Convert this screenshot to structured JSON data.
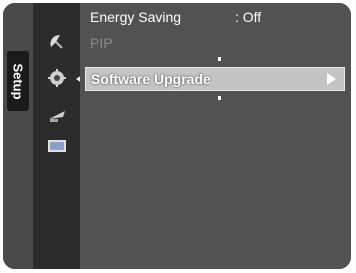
{
  "menu": {
    "tab_label": "Setup",
    "icons": [
      "satellite-dish-icon",
      "gear-icon",
      "antenna-icon",
      "screen-icon"
    ],
    "items": [
      {
        "label": "Energy Saving",
        "value": ": Off",
        "state": "normal"
      },
      {
        "label": "PIP",
        "value": "",
        "state": "disabled"
      },
      {
        "label": "Software Upgrade",
        "value": "",
        "state": "selected"
      }
    ]
  }
}
